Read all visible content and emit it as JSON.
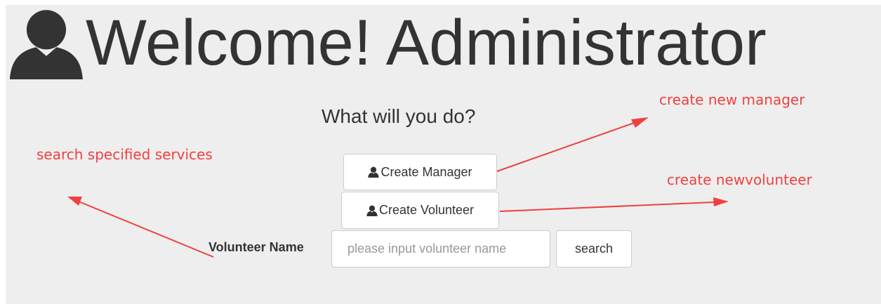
{
  "header": {
    "icon": "user-icon",
    "title": "Welcome! Administrator"
  },
  "prompt": "What will you do?",
  "actions": {
    "create_manager": {
      "label": "Create Manager",
      "icon": "user-icon"
    },
    "create_volunteer": {
      "label": "Create Volunteer",
      "icon": "user-icon"
    }
  },
  "search": {
    "label": "Volunteer Name",
    "placeholder": "please input volunteer name",
    "value": "",
    "button_label": "search"
  },
  "annotations": {
    "create_manager": "create new manager",
    "create_volunteer": "create newvolunteer",
    "search": "search specified services",
    "color": "#f04040"
  }
}
